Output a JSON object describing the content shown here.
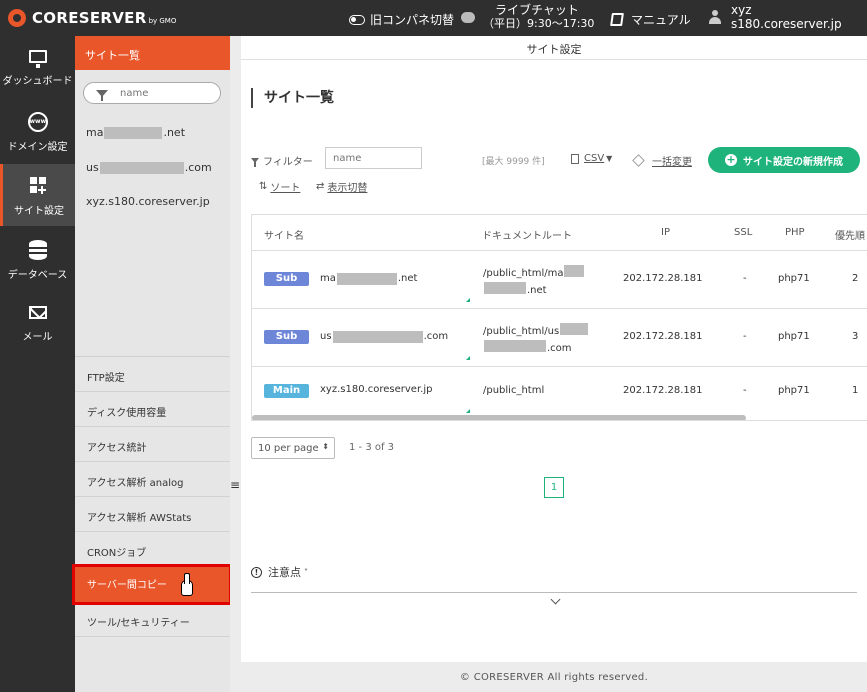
{
  "topbar": {
    "logo": "CORESERVER",
    "logo_sub": "by GMO",
    "legacy_panel": "旧コンパネ切替",
    "chat_title": "ライブチャット",
    "chat_hours": "（平日）9:30～17:30",
    "manual": "マニュアル",
    "user_name": "xyz",
    "user_server": "s180.coreserver.jp"
  },
  "leftnav": {
    "dashboard": "ダッシュボード",
    "domain": "ドメイン設定",
    "site": "サイト設定",
    "database": "データベース",
    "mail": "メール"
  },
  "subnav": {
    "header": "サイト一覧",
    "filter_placeholder": "name",
    "sites": [
      {
        "prefix": "ma",
        "suffix": ".net"
      },
      {
        "prefix": "us",
        "suffix": ".com"
      },
      {
        "full": "xyz.s180.coreserver.jp"
      }
    ],
    "menu": [
      "FTP設定",
      "ディスク使用容量",
      "アクセス統計",
      "アクセス解析 analog",
      "アクセス解析 AWStats",
      "CRONジョブ",
      "サーバー間コピー",
      "ツール/セキュリティー"
    ]
  },
  "main": {
    "header": "サイト設定",
    "title": "サイト一覧",
    "filter_label": "フィルター",
    "filter_placeholder": "name",
    "max_count": "[最大 9999 件]",
    "csv": "CSV",
    "bulk_change": "一括変更",
    "sort": "ソート",
    "display_toggle": "表示切替",
    "new_button": "サイト設定の新規作成",
    "columns": [
      "サイト名",
      "ドキュメントルート",
      "IP",
      "SSL",
      "PHP",
      "優先順"
    ],
    "rows": [
      {
        "type": "Sub",
        "name_prefix": "ma",
        "name_suffix": ".net",
        "doc_line1": "/public_html/ma",
        "doc_line2_suffix": ".net",
        "ip": "202.172.28.181",
        "ssl": "-",
        "php": "php71",
        "priority": "2"
      },
      {
        "type": "Sub",
        "name_prefix": "us",
        "name_suffix": ".com",
        "doc_line1": "/public_html/us",
        "doc_line2_suffix": ".com",
        "ip": "202.172.28.181",
        "ssl": "-",
        "php": "php71",
        "priority": "3"
      },
      {
        "type": "Main",
        "name": "xyz.s180.coreserver.jp",
        "doc_line1": "/public_html",
        "ip": "202.172.28.181",
        "ssl": "-",
        "php": "php71",
        "priority": "1"
      }
    ],
    "per_page": "10 per page",
    "range": "1 - 3 of 3",
    "page": "1",
    "notice": "注意点",
    "footer": "© CORESERVER All rights reserved."
  },
  "colors": {
    "accent": "#e8562a",
    "green": "#1fb37c",
    "sub_badge": "#6e86d8",
    "main_badge": "#57b4dd"
  }
}
